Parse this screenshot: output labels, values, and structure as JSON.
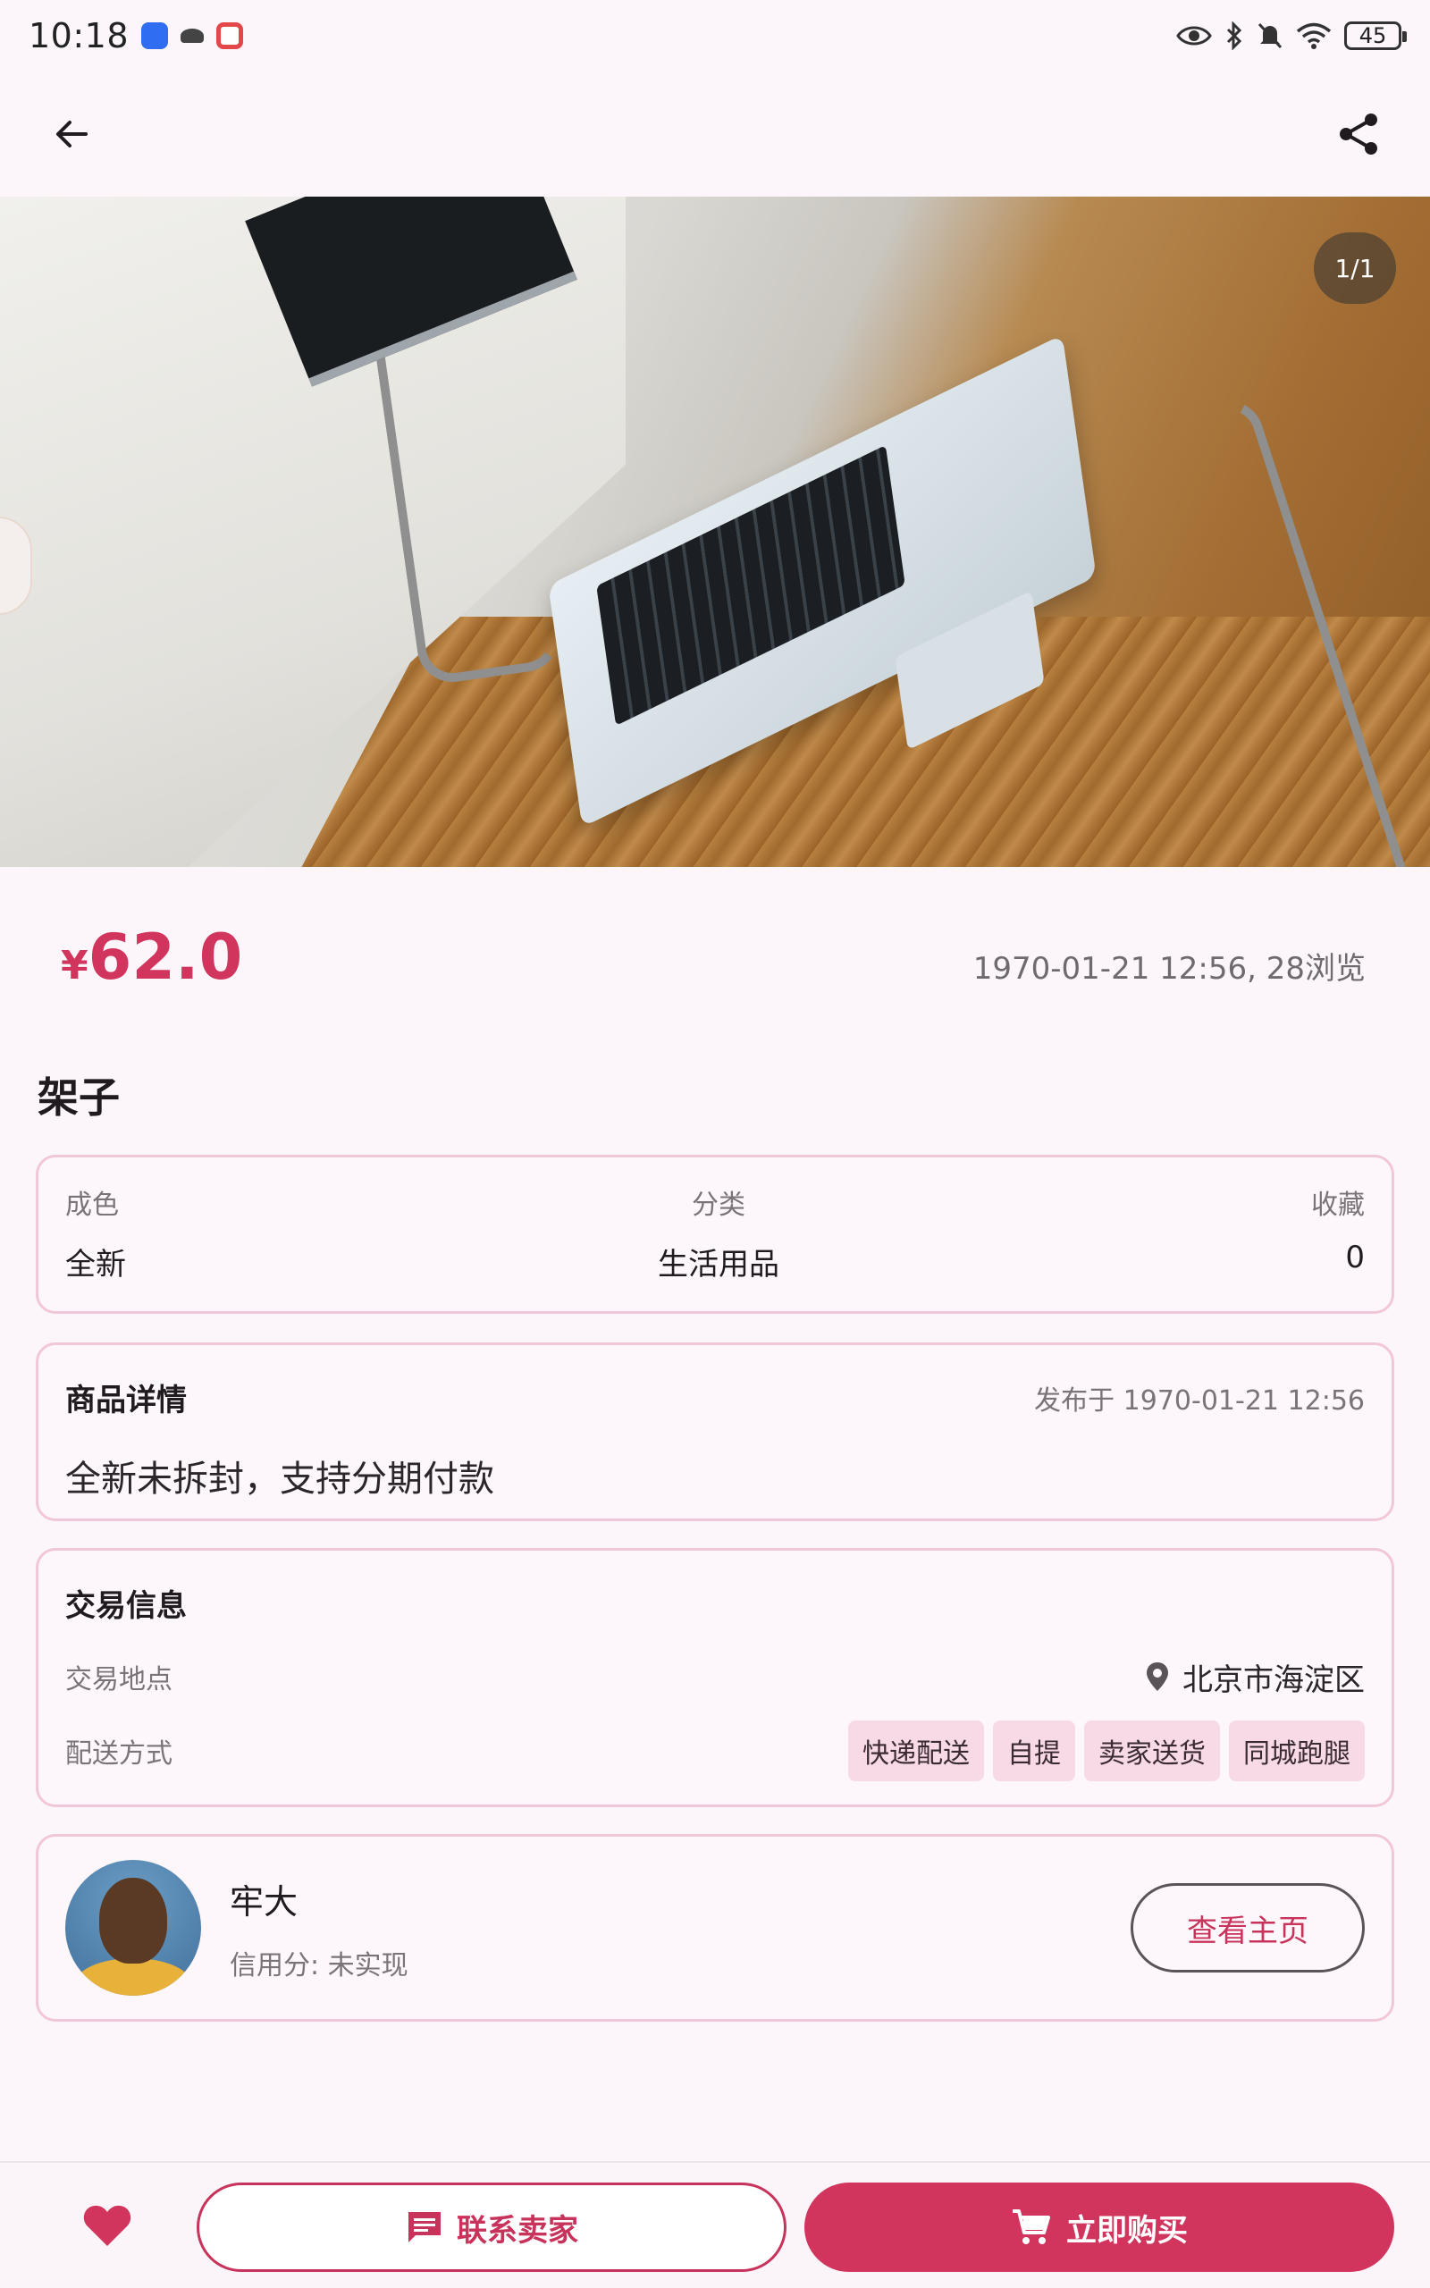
{
  "status_bar": {
    "time": "10:18",
    "battery": "45",
    "icons": [
      "app-blue-icon",
      "app-dark-icon",
      "app-red-icon",
      "eye-icon",
      "bluetooth-icon",
      "mute-icon",
      "wifi-icon",
      "battery-icon"
    ]
  },
  "top_bar": {
    "back_icon": "arrow-left-icon",
    "share_icon": "share-icon"
  },
  "gallery": {
    "counter": "1/1"
  },
  "product": {
    "currency": "¥",
    "price": "62.0",
    "meta": "1970-01-21 12:56, 28浏览",
    "title": "架子"
  },
  "attributes": {
    "condition_label": "成色",
    "condition_value": "全新",
    "category_label": "分类",
    "category_value": "生活用品",
    "favorites_label": "收藏",
    "favorites_value": "0"
  },
  "detail": {
    "title": "商品详情",
    "published": "发布于 1970-01-21 12:56",
    "body": "全新未拆封，支持分期付款"
  },
  "trade": {
    "title": "交易信息",
    "location_label": "交易地点",
    "location_value": "北京市海淀区",
    "shipping_label": "配送方式",
    "shipping_options": [
      "快递配送",
      "自提",
      "卖家送货",
      "同城跑腿"
    ]
  },
  "seller": {
    "name": "牢大",
    "credit": "信用分: 未实现",
    "home_button": "查看主页"
  },
  "bottom_bar": {
    "contact_label": "联系卖家",
    "buy_label": "立即购买"
  },
  "colors": {
    "accent": "#d1355d",
    "border": "#f1c7d6",
    "tag_bg": "#f8dae6",
    "background": "#fcf6fb"
  }
}
